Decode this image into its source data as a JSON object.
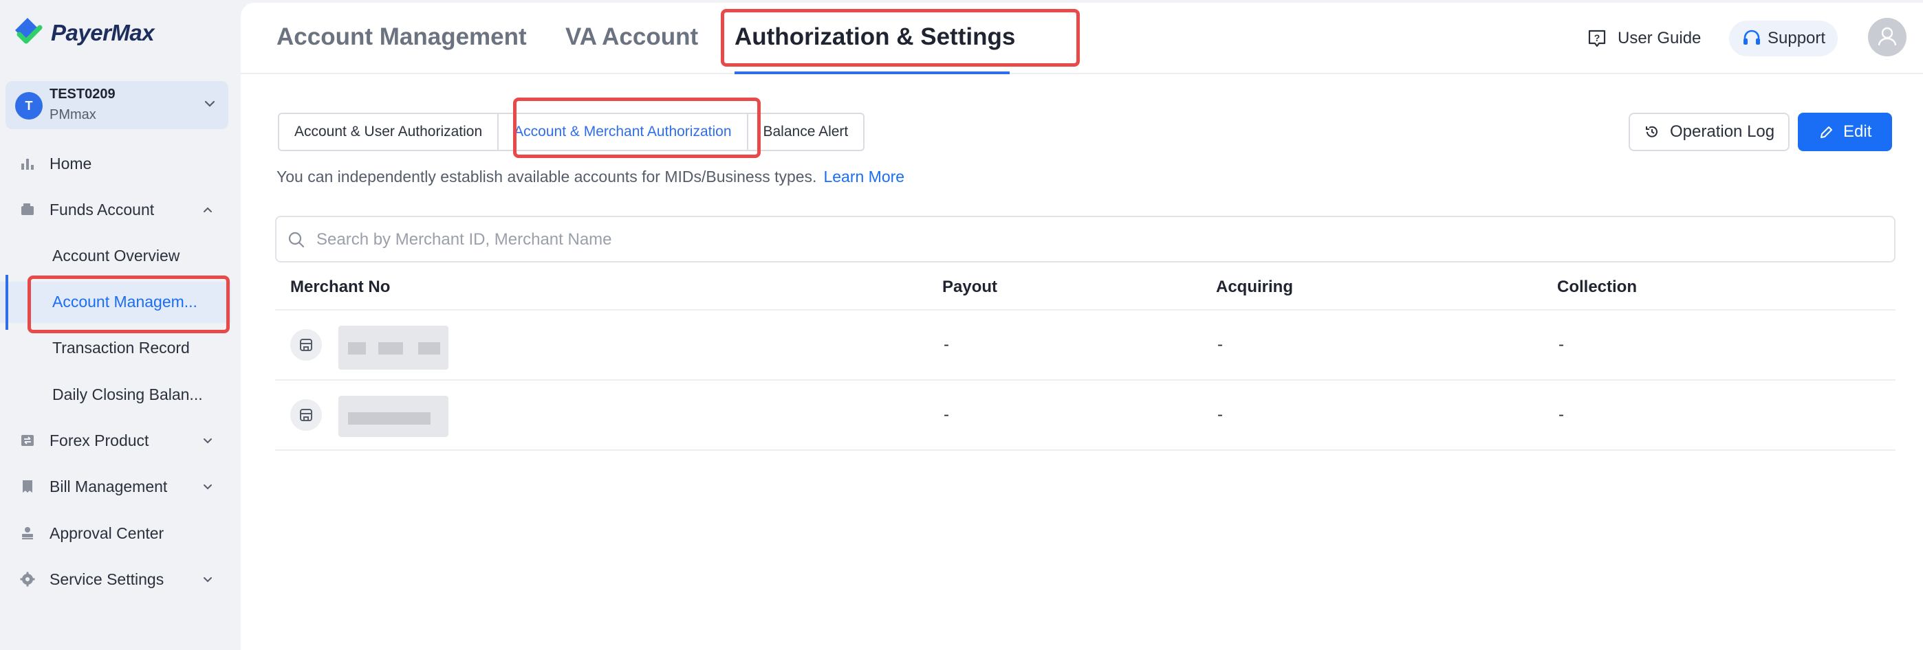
{
  "brand": {
    "name": "PayerMax"
  },
  "account": {
    "initial": "T",
    "name": "TEST0209",
    "sub": "PMmax"
  },
  "sidebar": {
    "items": [
      {
        "label": "Home"
      },
      {
        "label": "Funds Account"
      },
      {
        "label": "Account Overview"
      },
      {
        "label": "Account Managem..."
      },
      {
        "label": "Transaction Record"
      },
      {
        "label": "Daily Closing Balan..."
      },
      {
        "label": "Forex Product"
      },
      {
        "label": "Bill Management"
      },
      {
        "label": "Approval Center"
      },
      {
        "label": "Service Settings"
      }
    ]
  },
  "header": {
    "tabs": [
      {
        "label": "Account Management"
      },
      {
        "label": "VA Account"
      },
      {
        "label": "Authorization & Settings"
      }
    ],
    "user_guide": "User Guide",
    "support": "Support"
  },
  "subtabs": [
    {
      "label": "Account & User Authorization"
    },
    {
      "label": "Account & Merchant Authorization"
    },
    {
      "label": "Balance Alert"
    }
  ],
  "actions": {
    "operation_log": "Operation Log",
    "edit": "Edit"
  },
  "description": {
    "text": "You can independently establish available accounts for MIDs/Business types.",
    "link": "Learn More"
  },
  "search": {
    "placeholder": "Search by Merchant ID, Merchant Name"
  },
  "table": {
    "columns": [
      "Merchant No",
      "Payout",
      "Acquiring",
      "Collection"
    ],
    "rows": [
      {
        "payout": "-",
        "acquiring": "-",
        "collection": "-"
      },
      {
        "payout": "-",
        "acquiring": "-",
        "collection": "-"
      }
    ]
  },
  "colors": {
    "accent": "#1a6ef5",
    "highlight": "#e84a4a"
  }
}
